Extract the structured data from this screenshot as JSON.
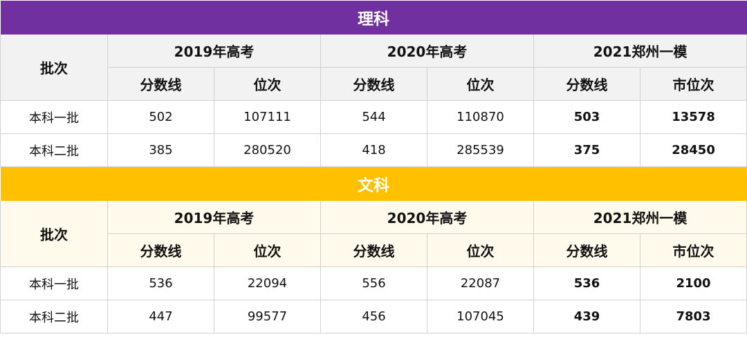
{
  "science": {
    "title": "理科",
    "batch_header": "批次",
    "year_headers": [
      "2019年高考",
      "2020年高考",
      "2021郑州一模"
    ],
    "sub_headers": [
      "分数线",
      "位次",
      "分数线",
      "位次",
      "分数线",
      "市位次"
    ],
    "rows": [
      {
        "batch": "本科一批",
        "cells": [
          "502",
          "107111",
          "544",
          "110870",
          "503",
          "13578"
        ]
      },
      {
        "batch": "本科二批",
        "cells": [
          "385",
          "280520",
          "418",
          "285539",
          "375",
          "28450"
        ]
      }
    ]
  },
  "arts": {
    "title": "文科",
    "batch_header": "批次",
    "year_headers": [
      "2019年高考",
      "2020年高考",
      "2021郑州一模"
    ],
    "sub_headers": [
      "分数线",
      "位次",
      "分数线",
      "位次",
      "分数线",
      "市位次"
    ],
    "rows": [
      {
        "batch": "本科一批",
        "cells": [
          "536",
          "22094",
          "556",
          "22087",
          "536",
          "2100"
        ]
      },
      {
        "batch": "本科二批",
        "cells": [
          "447",
          "99577",
          "456",
          "107045",
          "439",
          "7803"
        ]
      }
    ]
  },
  "colors": {
    "science_banner": "#7030a0",
    "arts_banner": "#ffc000",
    "science_header_bg": "#f2f2f2",
    "arts_header_bg": "#fffaeb"
  }
}
